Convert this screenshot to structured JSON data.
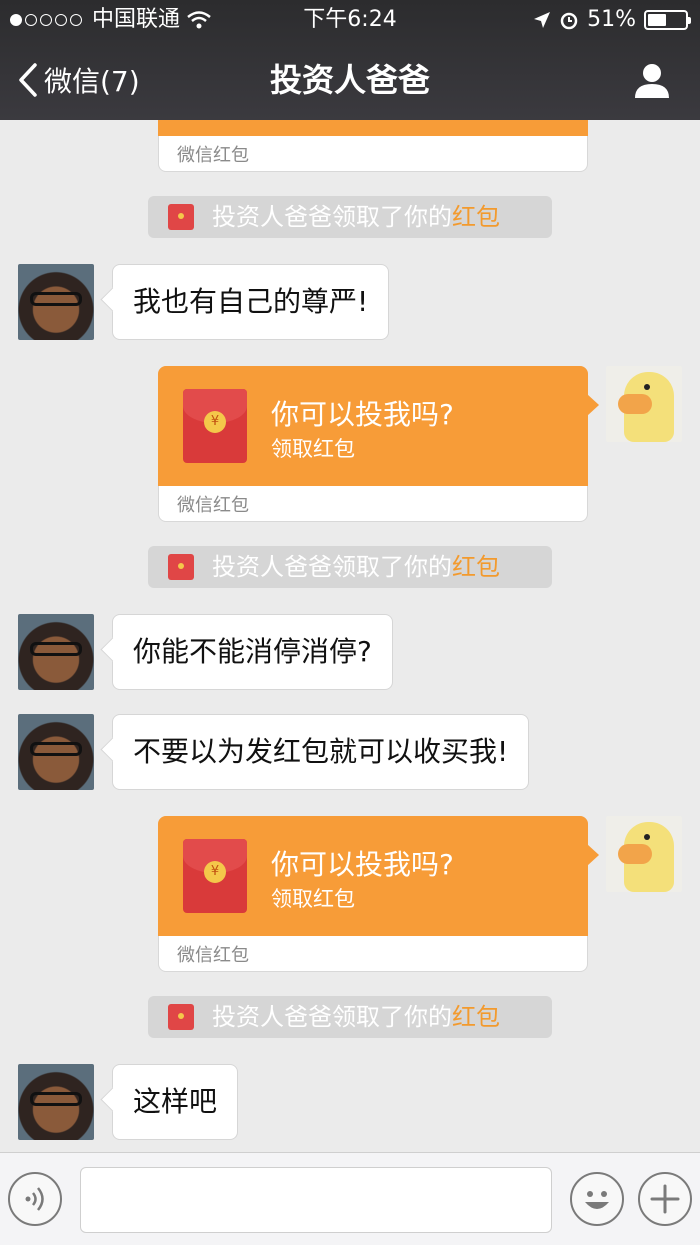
{
  "status_bar": {
    "carrier": "中国联通",
    "time": "下午6:24",
    "battery": "51%",
    "battery_level": 0.51
  },
  "navbar": {
    "back_label": "微信(7)",
    "title": "投资人爸爸"
  },
  "red_packet": {
    "footer": "微信红包",
    "title": "你可以投我吗?",
    "subtitle": "领取红包",
    "coin_symbol": "¥"
  },
  "system_notice": {
    "prefix": "投资人爸爸领取了你的",
    "highlight": "红包"
  },
  "messages": [
    {
      "text": "我也有自己的尊严!"
    },
    {
      "text": "你能不能消停消停?"
    },
    {
      "text": "不要以为发红包就可以收买我!"
    },
    {
      "text": "这样吧"
    }
  ],
  "colors": {
    "red_packet_orange": "#f79c38",
    "highlight": "#f39a2d",
    "chat_background": "#ebebeb"
  },
  "icons": {
    "voice": "voice-icon",
    "emoji": "emoji-icon",
    "plus": "plus-icon",
    "profile": "person-icon"
  }
}
